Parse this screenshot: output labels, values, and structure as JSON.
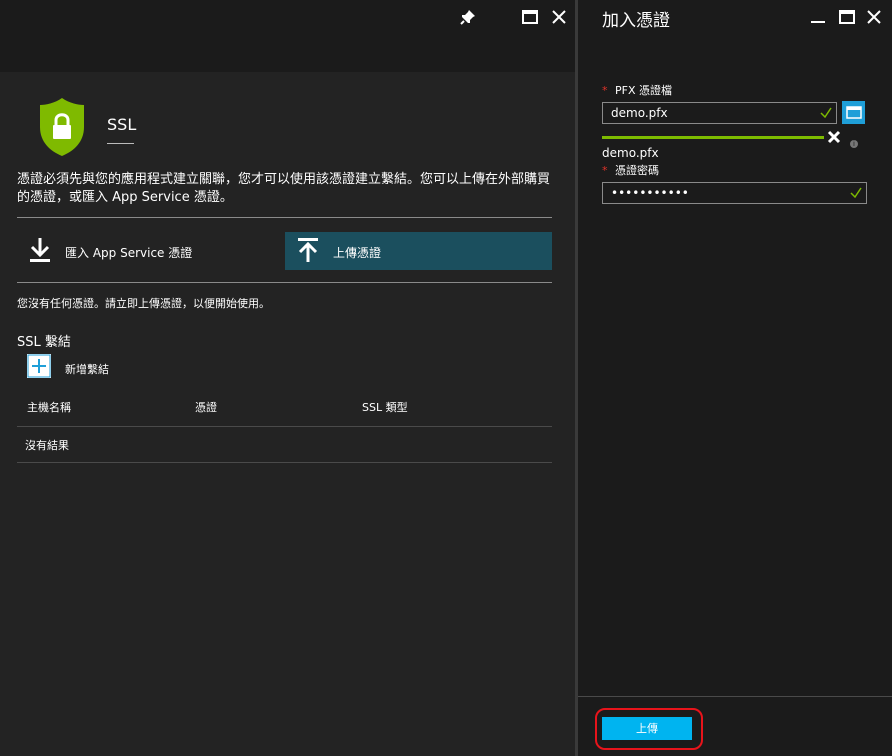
{
  "left_blade": {
    "title": "SSL",
    "description": "憑證必須先與您的應用程式建立關聯，您才可以使用該憑證建立繫結。您可以上傳在外部購買的憑證，或匯入 App Service 憑證。",
    "import_button": "匯入 App Service 憑證",
    "upload_button": "上傳憑證",
    "no_certs_message": "您沒有任何憑證。請立即上傳憑證，以便開始使用。",
    "bindings": {
      "title": "SSL 繫結",
      "add_label": "新增繫結",
      "columns": [
        "主機名稱",
        "憑證",
        "SSL 類型"
      ],
      "empty": "沒有結果"
    }
  },
  "right_blade": {
    "title": "加入憑證",
    "pfx_label": "PFX 憑證檔",
    "pfx_value": "demo.pfx",
    "uploaded_file": "demo.pfx",
    "password_label": "憑證密碼",
    "password_value": "•••••••••••",
    "upload_button": "上傳",
    "required_mark": "*"
  },
  "colors": {
    "accent_blue": "#00b4f0",
    "selected_button": "#1b4f5e",
    "progress_green": "#7dbb00",
    "shield_green": "#7fba00",
    "highlight_red": "#e8141b"
  }
}
